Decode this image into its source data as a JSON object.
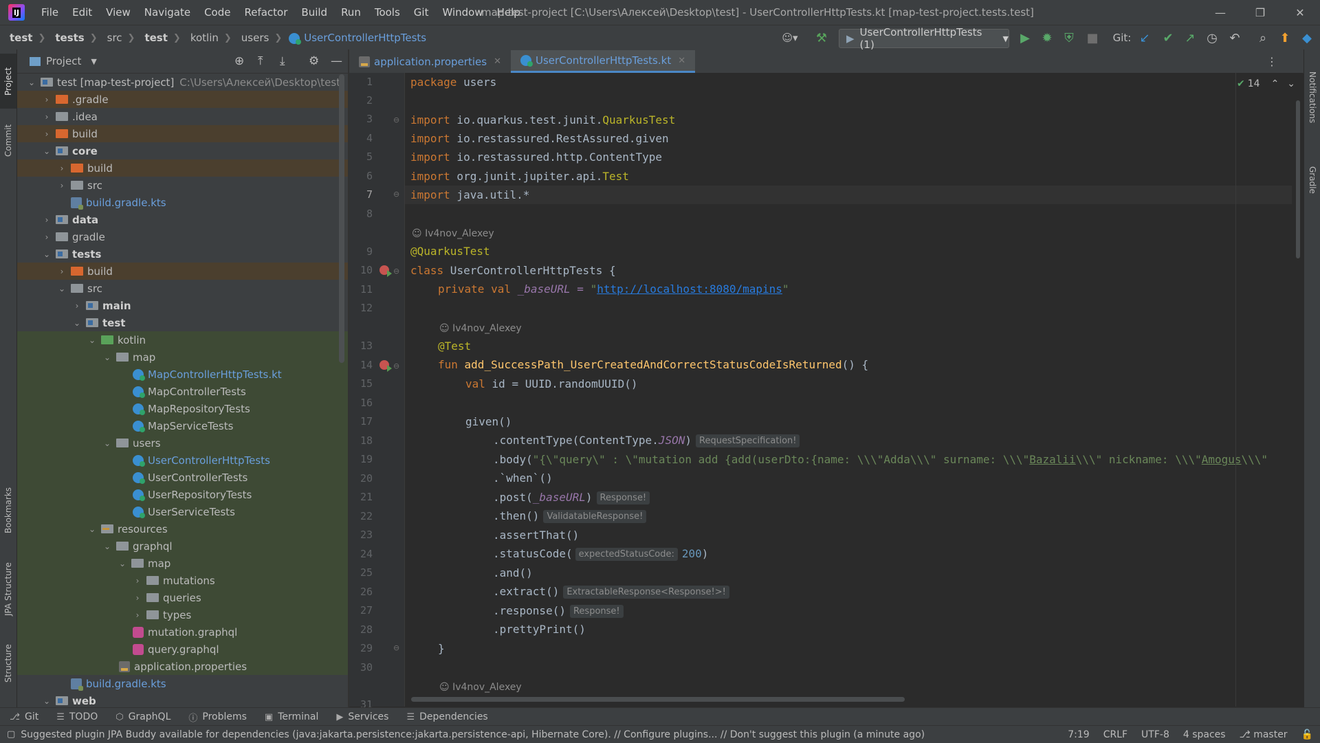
{
  "window": {
    "logo_text": "IJ",
    "title": "map-test-project [C:\\Users\\Алексей\\Desktop\\test] - UserControllerHttpTests.kt [map-test-project.tests.test]",
    "menu": [
      "File",
      "Edit",
      "View",
      "Navigate",
      "Code",
      "Refactor",
      "Build",
      "Run",
      "Tools",
      "Git",
      "Window",
      "Help"
    ]
  },
  "navbar": {
    "breadcrumbs": [
      "test",
      "tests",
      "src",
      "test",
      "kotlin",
      "users",
      "UserControllerHttpTests"
    ],
    "run_config": "UserControllerHttpTests (1)",
    "git_label": "Git:"
  },
  "left_stripe": [
    "Project",
    "Commit",
    "Bookmarks",
    "JPA Structure",
    "Structure"
  ],
  "right_stripe": [
    "Notifications",
    "Gradle"
  ],
  "project_panel": {
    "title": "Project",
    "root_name": "test [map-test-project]",
    "root_path": "C:\\Users\\Алексей\\Desktop\\test",
    "items": [
      {
        "label": ".gradle"
      },
      {
        "label": ".idea"
      },
      {
        "label": "build"
      },
      {
        "label": "core"
      },
      {
        "label": "build"
      },
      {
        "label": "src"
      },
      {
        "label": "build.gradle.kts"
      },
      {
        "label": "data"
      },
      {
        "label": "gradle"
      },
      {
        "label": "tests"
      },
      {
        "label": "build"
      },
      {
        "label": "src"
      },
      {
        "label": "main"
      },
      {
        "label": "test"
      },
      {
        "label": "kotlin"
      },
      {
        "label": "map"
      },
      {
        "label": "MapControllerHttpTests.kt"
      },
      {
        "label": "MapControllerTests"
      },
      {
        "label": "MapRepositoryTests"
      },
      {
        "label": "MapServiceTests"
      },
      {
        "label": "users"
      },
      {
        "label": "UserControllerHttpTests"
      },
      {
        "label": "UserControllerTests"
      },
      {
        "label": "UserRepositoryTests"
      },
      {
        "label": "UserServiceTests"
      },
      {
        "label": "resources"
      },
      {
        "label": "graphql"
      },
      {
        "label": "map"
      },
      {
        "label": "mutations"
      },
      {
        "label": "queries"
      },
      {
        "label": "types"
      },
      {
        "label": "mutation.graphql"
      },
      {
        "label": "query.graphql"
      },
      {
        "label": "application.properties"
      },
      {
        "label": "build.gradle.kts"
      },
      {
        "label": "web"
      }
    ]
  },
  "editor": {
    "tabs": [
      "application.properties",
      "UserControllerHttpTests.kt"
    ],
    "inspection_count": "14",
    "line_numbers": [
      "1",
      "2",
      "3",
      "4",
      "5",
      "6",
      "7",
      "8",
      "9",
      "10",
      "11",
      "12",
      "13",
      "14",
      "15",
      "16",
      "17",
      "18",
      "19",
      "20",
      "21",
      "22",
      "23",
      "24",
      "25",
      "26",
      "27",
      "28",
      "29",
      "30",
      "31"
    ],
    "authors": [
      "Iv4nov_Alexey",
      "Iv4nov_Alexey",
      "Iv4nov_Alexey"
    ],
    "code": {
      "l1_kw": "package",
      "l1_rest": " users",
      "imp_kw": "import",
      "l3_a": " io.quarkus.test.junit.",
      "l3_b": "QuarkusTest",
      "l4": " io.restassured.RestAssured.given",
      "l5": " io.restassured.http.ContentType",
      "l6_a": " org.junit.jupiter.api.",
      "l6_b": "Test",
      "l7": " java.util.*",
      "l9": "@QuarkusTest",
      "l10_kw": "class",
      "l10_rest": " UserControllerHttpTests {",
      "l11_kw": "private val",
      "l11_a": " _baseURL = ",
      "l11_q": "\"",
      "l11_url": "http://localhost:8080/mapins",
      "l11_q2": "\"",
      "l13": "@Test",
      "l14_kw": "fun",
      "l14_fn": " add_SuccessPath_UserCreatedAndCorrectStatusCodeIsReturned",
      "l14_rest": "() {",
      "l15_kw": "val",
      "l15_rest": " id = UUID.randomUUID()",
      "l17": "given()",
      "l18_a": ".contentType(ContentType.",
      "l18_b": "JSON",
      "l18_c": ")",
      "l18_hint": "RequestSpecification!",
      "l19_a": ".body(",
      "l19_str1": "\"{\\\"query\\\" : \\\"mutation add {add(userDto:{name: \\\\\\\"Adda\\\\\\\" surname: \\\\\\\"",
      "l19_u1": "Bazalii",
      "l19_str2": "\\\\\\\" nickname: \\\\\\\"",
      "l19_u2": "Amogus",
      "l19_str3": "\\\\\\\"",
      "l20": ".`when`()",
      "l21_a": ".post(",
      "l21_b": "_baseURL",
      "l21_c": ")",
      "l21_hint": "Response!",
      "l22": ".then()",
      "l22_hint": "ValidatableResponse!",
      "l23": ".assertThat()",
      "l24_a": ".statusCode(",
      "l24_hint": "expectedStatusCode:",
      "l24_num": "200",
      "l24_c": ")",
      "l25": ".and()",
      "l26": ".extract()",
      "l26_hint": "ExtractableResponse<Response!>!",
      "l27": ".response()",
      "l27_hint": "Response!",
      "l28": ".prettyPrint()",
      "l29": "}"
    }
  },
  "bottom_tools": [
    "Git",
    "TODO",
    "GraphQL",
    "Problems",
    "Terminal",
    "Services",
    "Dependencies"
  ],
  "status": {
    "message": "Suggested plugin JPA Buddy available for dependencies (java:jakarta.persistence:jakarta.persistence-api, Hibernate Core). // Configure plugins... // Don't suggest this plugin (a minute ago)",
    "position": "7:19",
    "line_sep": "CRLF",
    "encoding": "UTF-8",
    "indent": "4 spaces",
    "branch": "master"
  }
}
